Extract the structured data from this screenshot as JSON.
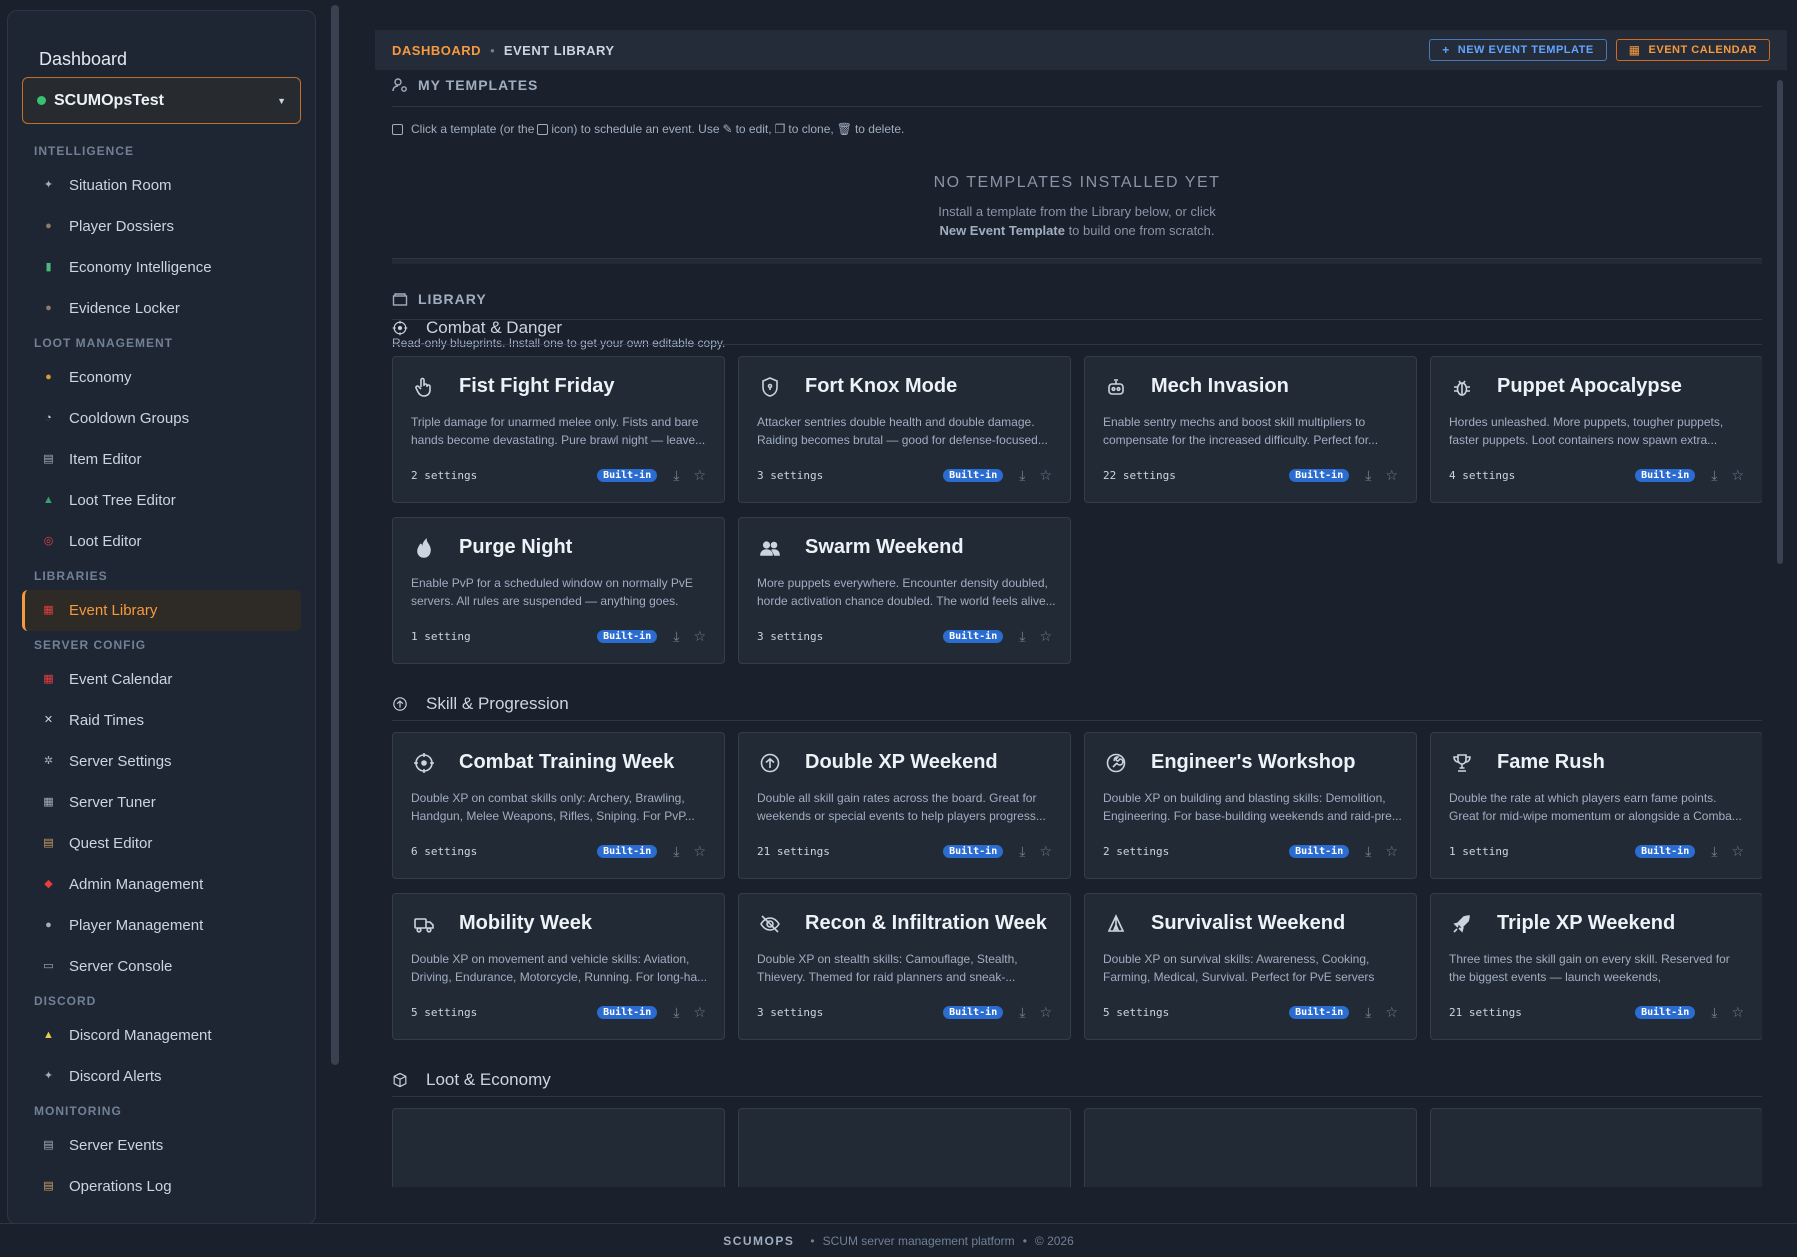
{
  "sidebar": {
    "title": "Dashboard",
    "server": {
      "name": "SCUMOpsTest",
      "status_color": "#38c172"
    },
    "sections": [
      {
        "label": "INTELLIGENCE",
        "items": [
          {
            "label": "Situation Room",
            "icon": "satellite-icon",
            "color": "#a0aec0",
            "glyph": "✦"
          },
          {
            "label": "Player Dossiers",
            "icon": "detective-icon",
            "color": "#8b7b6b",
            "glyph": "●"
          },
          {
            "label": "Economy Intelligence",
            "icon": "bar-chart-icon",
            "color": "#48bb78",
            "glyph": "▮"
          },
          {
            "label": "Evidence Locker",
            "icon": "detective-icon",
            "color": "#8b7b6b",
            "glyph": "●"
          }
        ]
      },
      {
        "label": "LOOT MANAGEMENT",
        "items": [
          {
            "label": "Economy",
            "icon": "money-bag-icon",
            "color": "#d69e2e",
            "glyph": "●"
          },
          {
            "label": "Cooldown Groups",
            "icon": "stopwatch-icon",
            "color": "#cbd5e0",
            "glyph": "◔"
          },
          {
            "label": "Item Editor",
            "icon": "clipboard-icon",
            "color": "#a0aec0",
            "glyph": "▤"
          },
          {
            "label": "Loot Tree Editor",
            "icon": "tree-icon",
            "color": "#38a169",
            "glyph": "▲"
          },
          {
            "label": "Loot Editor",
            "icon": "target-icon",
            "color": "#e53e3e",
            "glyph": "◎"
          }
        ]
      },
      {
        "label": "LIBRARIES",
        "items": [
          {
            "label": "Event Library",
            "icon": "calendar-icon",
            "color": "#e53e3e",
            "glyph": "▦",
            "active": true
          }
        ]
      },
      {
        "label": "SERVER CONFIG",
        "items": [
          {
            "label": "Event Calendar",
            "icon": "calendar-icon",
            "color": "#e53e3e",
            "glyph": "▦"
          },
          {
            "label": "Raid Times",
            "icon": "crossed-swords-icon",
            "color": "#cbd5e0",
            "glyph": "✕"
          },
          {
            "label": "Server Settings",
            "icon": "gear-icon",
            "color": "#a0aec0",
            "glyph": "✲"
          },
          {
            "label": "Server Tuner",
            "icon": "control-knobs-icon",
            "color": "#a0aec0",
            "glyph": "▦"
          },
          {
            "label": "Quest Editor",
            "icon": "scroll-icon",
            "color": "#c8a165",
            "glyph": "▤"
          },
          {
            "label": "Admin Management",
            "icon": "shield-icon",
            "color": "#e53e3e",
            "glyph": "◆"
          },
          {
            "label": "Player Management",
            "icon": "person-icon",
            "color": "#a0aec0",
            "glyph": "●"
          },
          {
            "label": "Server Console",
            "icon": "desktop-icon",
            "color": "#a0aec0",
            "glyph": "▭"
          }
        ]
      },
      {
        "label": "DISCORD",
        "items": [
          {
            "label": "Discord Management",
            "icon": "bell-icon",
            "color": "#ecc94b",
            "glyph": "▲"
          },
          {
            "label": "Discord Alerts",
            "icon": "satellite-icon",
            "color": "#a0aec0",
            "glyph": "✦"
          }
        ]
      },
      {
        "label": "MONITORING",
        "items": [
          {
            "label": "Server Events",
            "icon": "clipboard-icon",
            "color": "#a0aec0",
            "glyph": "▤"
          },
          {
            "label": "Operations Log",
            "icon": "scroll-icon",
            "color": "#c8a165",
            "glyph": "▤"
          }
        ]
      }
    ]
  },
  "topbar": {
    "breadcrumb_home": "DASHBOARD",
    "breadcrumb_current": "EVENT LIBRARY",
    "new_template_label": "NEW EVENT TEMPLATE",
    "calendar_label": "EVENT CALENDAR"
  },
  "my_templates": {
    "title": "MY TEMPLATES",
    "help_parts": [
      "Click a template (or the",
      "icon) to schedule an event. Use",
      "to edit,",
      "to clone,",
      "to delete."
    ],
    "empty_title": "NO TEMPLATES INSTALLED YET",
    "empty_line1": "Install a template from the Library below, or click",
    "empty_line2_bold": "New Event Template",
    "empty_line2_rest": "to build one from scratch."
  },
  "library": {
    "title": "LIBRARY",
    "help": "Read-only blueprints. Install one to get your own editable copy.",
    "badge": "Built-in",
    "categories": [
      {
        "name": "Combat & Danger",
        "icon": "crosshair-icon",
        "cards": [
          {
            "title": "Fist Fight Friday",
            "icon": "hand-pointer-icon",
            "desc": "Triple damage for unarmed melee only. Fists and bare hands become devastating. Pure brawl night — leave...",
            "settings": "2 settings"
          },
          {
            "title": "Fort Knox Mode",
            "icon": "shield-icon",
            "desc": "Attacker sentries double health and double damage. Raiding becomes brutal — good for defense-focused...",
            "settings": "3 settings"
          },
          {
            "title": "Mech Invasion",
            "icon": "robot-icon",
            "desc": "Enable sentry mechs and boost skill multipliers to compensate for the increased difficulty. Perfect for...",
            "settings": "22 settings"
          },
          {
            "title": "Puppet Apocalypse",
            "icon": "bug-icon",
            "desc": "Hordes unleashed. More puppets, tougher puppets, faster puppets. Loot containers now spawn extra...",
            "settings": "4 settings"
          },
          {
            "title": "Purge Night",
            "icon": "flame-icon",
            "desc": "Enable PvP for a scheduled window on normally PvE servers. All rules are suspended — anything goes.",
            "settings": "1 setting"
          },
          {
            "title": "Swarm Weekend",
            "icon": "users-icon",
            "desc": "More puppets everywhere. Encounter density doubled, horde activation chance doubled. The world feels alive...",
            "settings": "3 settings"
          }
        ]
      },
      {
        "name": "Skill & Progression",
        "icon": "arrow-up-circle-icon",
        "cards": [
          {
            "title": "Combat Training Week",
            "icon": "crosshair-icon",
            "desc": "Double XP on combat skills only: Archery, Brawling, Handgun, Melee Weapons, Rifles, Sniping. For PvP...",
            "settings": "6 settings"
          },
          {
            "title": "Double XP Weekend",
            "icon": "arrow-up-circle-icon",
            "desc": "Double all skill gain rates across the board. Great for weekends or special events to help players progress...",
            "settings": "21 settings"
          },
          {
            "title": "Engineer's Workshop",
            "icon": "wrench-icon",
            "desc": "Double XP on building and blasting skills: Demolition, Engineering. For base-building weekends and raid-pre...",
            "settings": "2 settings"
          },
          {
            "title": "Fame Rush",
            "icon": "trophy-icon",
            "desc": "Double the rate at which players earn fame points. Great for mid-wipe momentum or alongside a Comba...",
            "settings": "1 setting"
          },
          {
            "title": "Mobility Week",
            "icon": "truck-icon",
            "desc": "Double XP on movement and vehicle skills: Aviation, Driving, Endurance, Motorcycle, Running. For long-ha...",
            "settings": "5 settings"
          },
          {
            "title": "Recon & Infiltration Week",
            "icon": "eye-off-icon",
            "desc": "Double XP on stealth skills: Camouflage, Stealth, Thievery. Themed for raid planners and sneak-...",
            "settings": "3 settings"
          },
          {
            "title": "Survivalist Weekend",
            "icon": "tent-icon",
            "desc": "Double XP on survival skills: Awareness, Cooking, Farming, Medical, Survival. Perfect for PvE servers and...",
            "settings": "5 settings"
          },
          {
            "title": "Triple XP Weekend",
            "icon": "rocket-icon",
            "desc": "Three times the skill gain on every skill. Reserved for the biggest events — launch weekends, anniversaries,...",
            "settings": "21 settings"
          }
        ]
      },
      {
        "name": "Loot & Economy",
        "icon": "box-icon",
        "cards": []
      }
    ]
  },
  "footer": {
    "brand": "SCUMOPS",
    "tagline": "SCUM server management platform",
    "copyright": "© 2026"
  }
}
